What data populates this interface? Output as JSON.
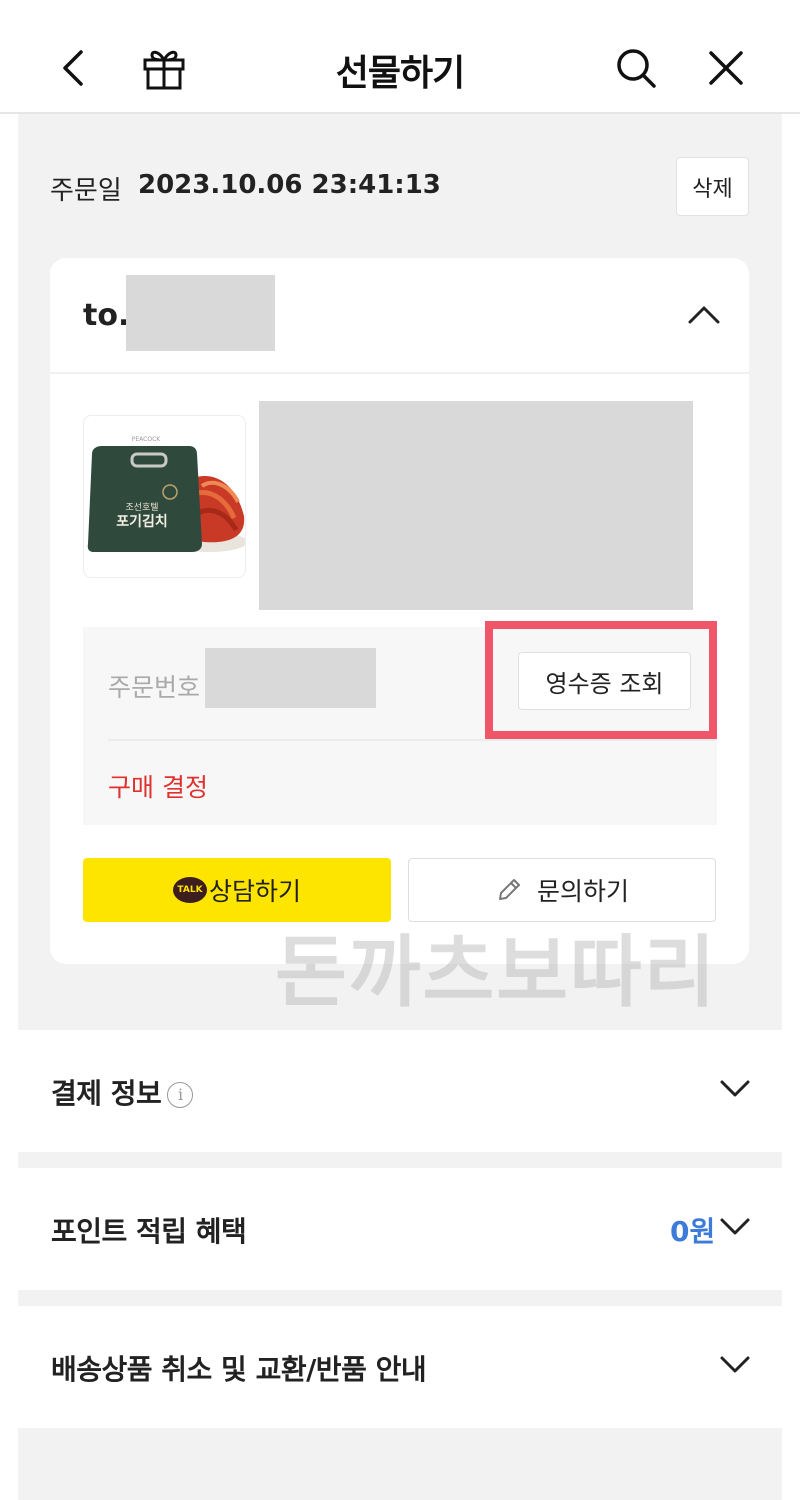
{
  "header": {
    "title": "선물하기",
    "icons": [
      "back-icon",
      "gift-icon",
      "search-icon",
      "close-icon"
    ]
  },
  "order": {
    "date_label": "주문일",
    "date_value": "2023.10.06 23:41:13",
    "delete_label": "삭제"
  },
  "card": {
    "to_label": "to.",
    "order_number_label": "주문번호",
    "receipt_button": "영수증 조회",
    "purchase_confirm": "구매 결정",
    "talk_button": "상담하기",
    "talk_icon_text": "TALK",
    "inquiry_button": "문의하기",
    "product_image": {
      "bag_text_line1": "조선호텔",
      "bag_text_line2": "포기김치",
      "bag_top_text": "PEACOCK"
    }
  },
  "watermark": "돈까츠보따리",
  "sections": {
    "payment": {
      "title": "결제 정보",
      "info_icon": "i"
    },
    "points": {
      "title": "포인트 적립 혜택",
      "value": "0원"
    },
    "shipping": {
      "title": "배송상품 취소 및 교환/반품 안내"
    }
  },
  "colors": {
    "kakao_yellow": "#fee500",
    "highlight": "#f0566a",
    "purchase_red": "#e03131",
    "points_blue": "#3d7bd9",
    "background": "#f2f2f2"
  }
}
